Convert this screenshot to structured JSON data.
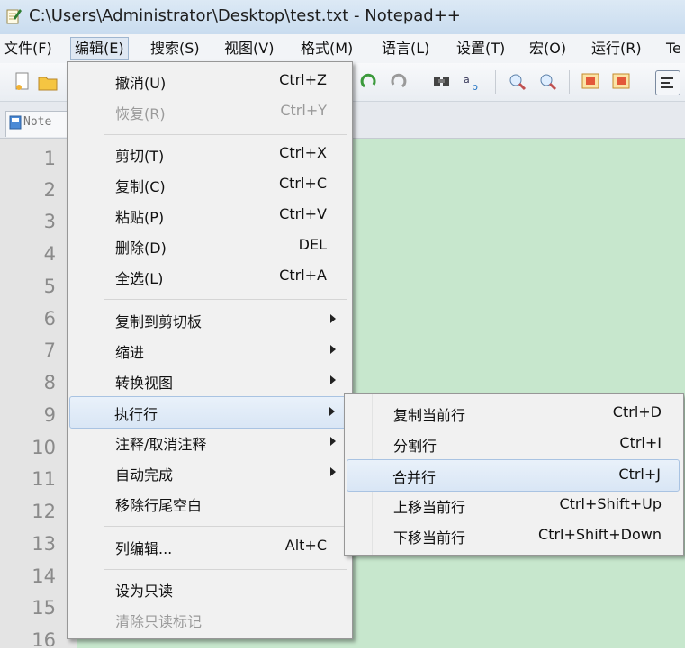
{
  "window": {
    "title": "C:\\Users\\Administrator\\Desktop\\test.txt - Notepad++"
  },
  "menubar": [
    {
      "label": "文件(F)"
    },
    {
      "label": "编辑(E)"
    },
    {
      "label": "搜索(S)"
    },
    {
      "label": "视图(V)"
    },
    {
      "label": "格式(M)"
    },
    {
      "label": "语言(L)"
    },
    {
      "label": "设置(T)"
    },
    {
      "label": "宏(O)"
    },
    {
      "label": "运行(R)"
    },
    {
      "label": "Te"
    }
  ],
  "tab": {
    "label": "Note"
  },
  "line_numbers": [
    "1",
    "2",
    "3",
    "4",
    "5",
    "6",
    "7",
    "8",
    "9",
    "10",
    "11",
    "12",
    "13",
    "14",
    "15",
    "16"
  ],
  "edit_menu": {
    "items": [
      {
        "label": "撤消(U)",
        "shortcut": "Ctrl+Z"
      },
      {
        "label": "恢复(R)",
        "shortcut": "Ctrl+Y",
        "disabled": true
      },
      {
        "label": "剪切(T)",
        "shortcut": "Ctrl+X"
      },
      {
        "label": "复制(C)",
        "shortcut": "Ctrl+C"
      },
      {
        "label": "粘贴(P)",
        "shortcut": "Ctrl+V"
      },
      {
        "label": "删除(D)",
        "shortcut": "DEL"
      },
      {
        "label": "全选(L)",
        "shortcut": "Ctrl+A"
      },
      {
        "label": "复制到剪切板"
      },
      {
        "label": "缩进"
      },
      {
        "label": "转换视图"
      },
      {
        "label": "执行行"
      },
      {
        "label": "注释/取消注释"
      },
      {
        "label": "自动完成"
      },
      {
        "label": "移除行尾空白"
      },
      {
        "label": "列编辑...",
        "shortcut": "Alt+C"
      },
      {
        "label": "设为只读"
      },
      {
        "label": "清除只读标记",
        "disabled": true
      }
    ]
  },
  "line_ops_submenu": {
    "items": [
      {
        "label": "复制当前行",
        "shortcut": "Ctrl+D"
      },
      {
        "label": "分割行",
        "shortcut": "Ctrl+I"
      },
      {
        "label": "合并行",
        "shortcut": "Ctrl+J"
      },
      {
        "label": "上移当前行",
        "shortcut": "Ctrl+Shift+Up"
      },
      {
        "label": "下移当前行",
        "shortcut": "Ctrl+Shift+Down"
      }
    ]
  }
}
